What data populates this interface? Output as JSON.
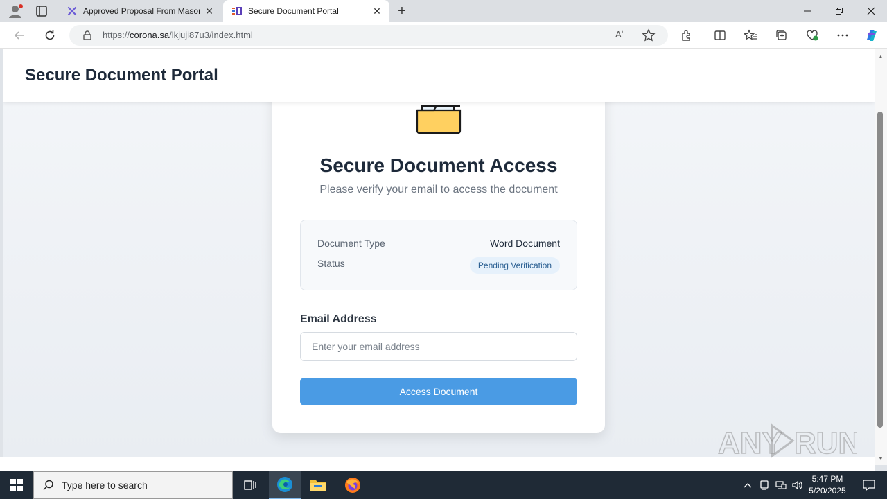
{
  "browser": {
    "tabs": [
      {
        "title": "Approved Proposal From Mason",
        "active": false
      },
      {
        "title": "Secure Document Portal",
        "active": true
      }
    ],
    "url_domain": "corona.sa",
    "url_prefix": "https://",
    "url_path": "/lkjuji87u3/index.html",
    "read_aloud_label": "Aʼ"
  },
  "site": {
    "header_title": "Secure Document Portal"
  },
  "card": {
    "title": "Secure Document Access",
    "subtitle": "Please verify your email to access the document",
    "info": {
      "doc_type_label": "Document Type",
      "doc_type_value": "Word Document",
      "status_label": "Status",
      "status_value": "Pending Verification"
    },
    "email_label": "Email Address",
    "email_placeholder": "Enter your email address",
    "email_value": "",
    "submit_label": "Access Document"
  },
  "watermark": "ANY RUN",
  "taskbar": {
    "search_placeholder": "Type here to search",
    "time": "5:47 PM",
    "date": "5/20/2025"
  },
  "colors": {
    "accent_button": "#4a9be4",
    "badge_bg": "#e6f1fb",
    "badge_text": "#2a5f92",
    "heading": "#1e2a3a",
    "folder_fill": "#ffd060"
  }
}
